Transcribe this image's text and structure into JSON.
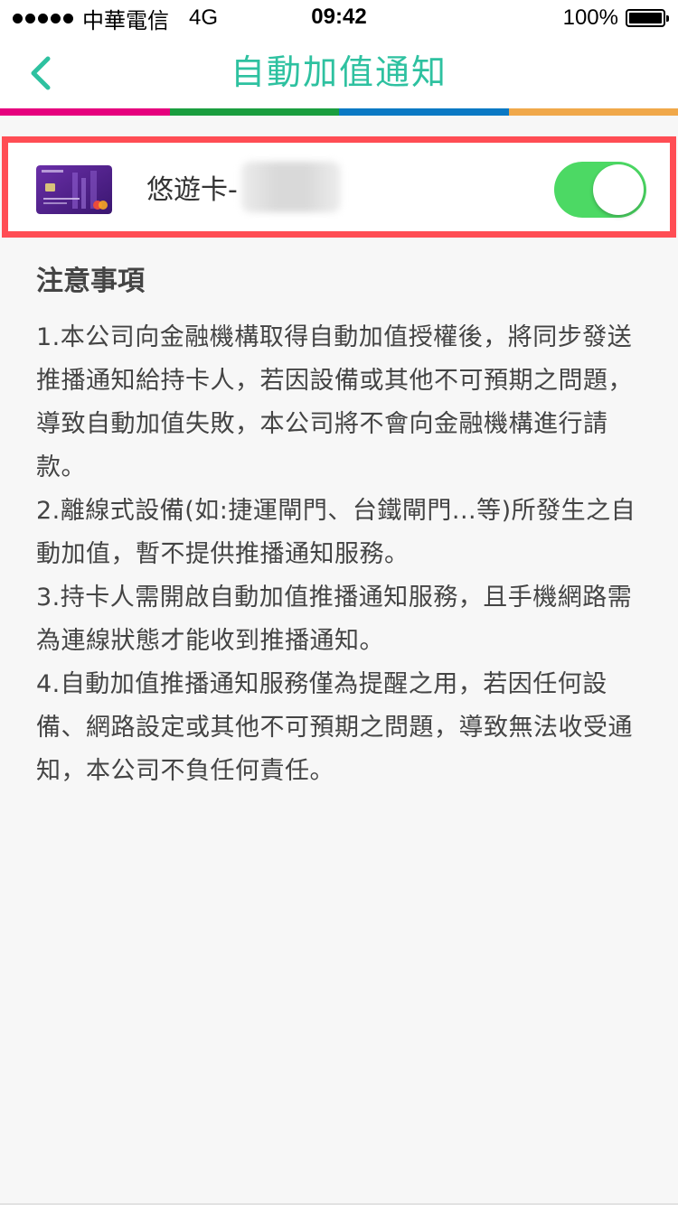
{
  "status_bar": {
    "carrier": "中華電信",
    "network": "4G",
    "time": "09:42",
    "battery": "100%"
  },
  "nav": {
    "title": "自動加值通知",
    "back_icon": "chevron-left-icon",
    "accent_color": "#2ec1a0"
  },
  "color_strip": [
    "#e6007e",
    "#1a9e3f",
    "#0a79c4",
    "#f0a84a"
  ],
  "card_row": {
    "name": "悠遊卡-",
    "notification_enabled": true,
    "toggle_color": "#4cd964",
    "highlight_color": "#ff4d54"
  },
  "notes": {
    "heading": "注意事項",
    "items": [
      "1.本公司向金融機構取得自動加值授權後，將同步發送推播通知給持卡人，若因設備或其他不可預期之問題，導致自動加值失敗，本公司將不會向金融機構進行請款。",
      "2.離線式設備(如:捷運閘門、台鐵閘門...等)所發生之自動加值，暫不提供推播通知服務。",
      "3.持卡人需開啟自動加值推播通知服務，且手機網路需為連線狀態才能收到推播通知。",
      "4.自動加值推播通知服務僅為提醒之用，若因任何設備、網路設定或其他不可預期之問題，導致無法收受通知，本公司不負任何責任。"
    ]
  }
}
